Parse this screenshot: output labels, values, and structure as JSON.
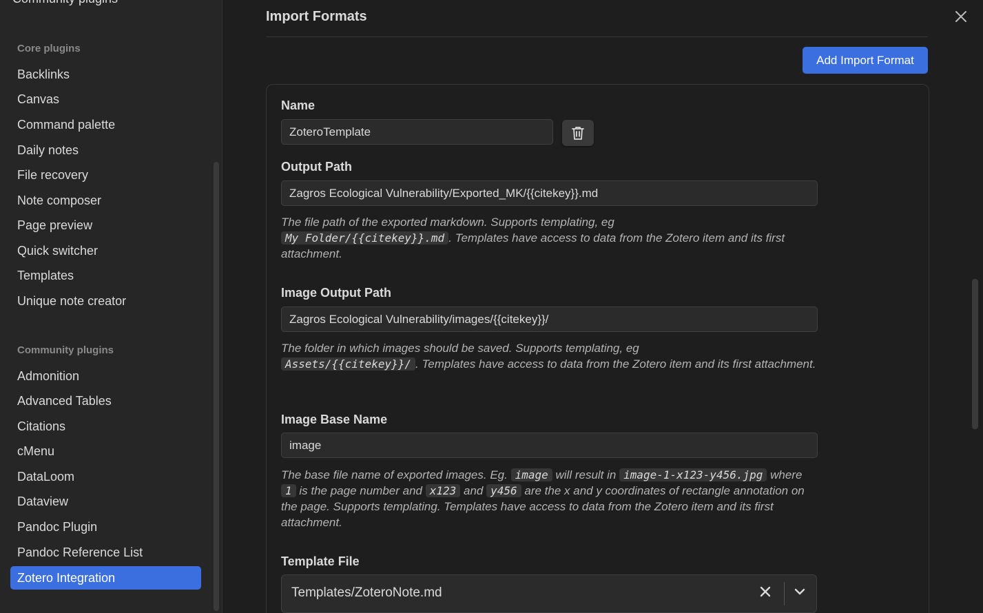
{
  "sidebar": {
    "cut_top_label": "Community plugins",
    "core_title": "Core plugins",
    "core_items": [
      "Backlinks",
      "Canvas",
      "Command palette",
      "Daily notes",
      "File recovery",
      "Note composer",
      "Page preview",
      "Quick switcher",
      "Templates",
      "Unique note creator"
    ],
    "community_title": "Community plugins",
    "community_items": [
      "Admonition",
      "Advanced Tables",
      "Citations",
      "cMenu",
      "DataLoom",
      "Dataview",
      "Pandoc Plugin",
      "Pandoc Reference List",
      "Zotero Integration"
    ],
    "active_item": "Zotero Integration"
  },
  "main": {
    "section_title": "Import Formats",
    "add_button": "Add Import Format",
    "name": {
      "label": "Name",
      "value": "ZoteroTemplate"
    },
    "output_path": {
      "label": "Output Path",
      "value": "Zagros Ecological Vulnerability/Exported_MK/{{citekey}}.md",
      "desc_1": "The file path of the exported markdown. Supports templating, eg",
      "desc_code": "My Folder/{{citekey}}.md",
      "desc_2": ". Templates have access to data from the Zotero item and its first attachment."
    },
    "image_output_path": {
      "label": "Image Output Path",
      "value": "Zagros Ecological Vulnerability/images/{{citekey}}/",
      "desc_1": "The folder in which images should be saved. Supports templating, eg",
      "desc_code": "Assets/{{citekey}}/",
      "desc_2": ". Templates have access to data from the Zotero item and its first attachment."
    },
    "image_base_name": {
      "label": "Image Base Name",
      "value": "image",
      "desc_1": "The base file name of exported images. Eg.",
      "code_1": "image",
      "desc_2": "will result in",
      "code_2": "image-1-x123-y456.jpg",
      "desc_3": "where",
      "code_3": "1",
      "desc_4": "is the page number and",
      "code_4": "x123",
      "desc_5": "and",
      "code_5": "y456",
      "desc_6": "are the x and y coordinates of rectangle annotation on the page. Supports templating. Templates have access to data from the Zotero item and its first attachment."
    },
    "template_file": {
      "label": "Template File",
      "value": "Templates/ZoteroNote.md"
    }
  },
  "colors": {
    "accent": "#3b6fe0",
    "background": "#1e1e1e",
    "sidebar": "#262626"
  }
}
